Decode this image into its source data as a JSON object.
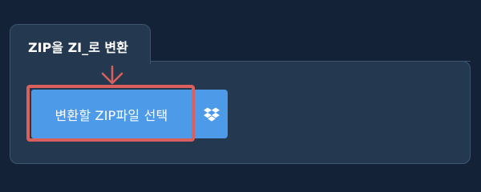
{
  "converter": {
    "title": "ZIP을 ZI_로 변환",
    "select_button_label": "변환할 ZIP파일 선택",
    "dropbox_icon": "dropbox-icon",
    "pointer_icon": "arrow-down-icon"
  },
  "colors": {
    "page_background": "#132236",
    "panel_background": "#24384f",
    "panel_border": "#3c5670",
    "button": "#4d9be8",
    "highlight": "#d9605c"
  }
}
